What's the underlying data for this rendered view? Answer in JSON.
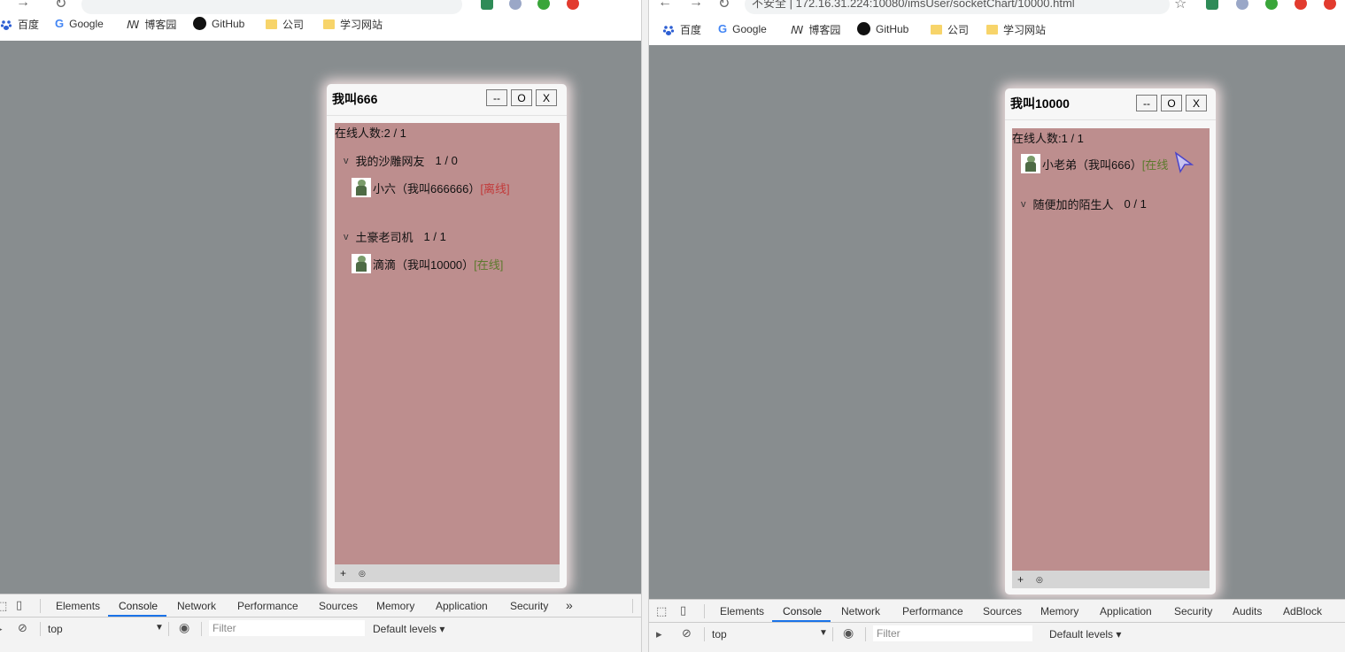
{
  "left": {
    "bookmarks": [
      "百度",
      "Google",
      "博客园",
      "GitHub",
      "公司",
      "学习网站"
    ],
    "qq": {
      "title": "我叫666",
      "buttons": [
        "--",
        "O",
        "X"
      ],
      "online": "在线人数:2 / 1",
      "groups": [
        {
          "name": "我的沙雕网友",
          "count": "1 / 0",
          "friend": {
            "name": "小六（我叫666666）",
            "status": "[离线]"
          }
        },
        {
          "name": "土豪老司机",
          "count": "1 / 1",
          "friend": {
            "name": "滴滴（我叫10000）",
            "status": "[在线]"
          }
        }
      ],
      "bottom": [
        "+",
        "◎"
      ]
    },
    "devtools": {
      "tabs": [
        "Elements",
        "Console",
        "Network",
        "Performance",
        "Sources",
        "Memory",
        "Application",
        "Security",
        "»"
      ],
      "active_tab": "Console",
      "context": "top",
      "filter_placeholder": "Filter",
      "levels": "Default levels ▾"
    }
  },
  "right": {
    "address": "不安全 | 172.16.31.224:10080/imsUser/socketChart/10000.html",
    "bookmarks": [
      "百度",
      "Google",
      "博客园",
      "GitHub",
      "公司",
      "学习网站"
    ],
    "qq": {
      "title": "我叫10000",
      "buttons": [
        "--",
        "O",
        "X"
      ],
      "online": "在线人数:1 / 1",
      "top_friend": {
        "name": "小老弟（我叫666）",
        "status": "[在线"
      },
      "groups": [
        {
          "name": "随便加的陌生人",
          "count": "0 / 1"
        }
      ],
      "bottom": [
        "+",
        "◎"
      ]
    },
    "devtools": {
      "tabs": [
        "Elements",
        "Console",
        "Network",
        "Performance",
        "Sources",
        "Memory",
        "Application",
        "Security",
        "Audits",
        "AdBlock"
      ],
      "active_tab": "Console",
      "context": "top",
      "filter_placeholder": "Filter",
      "levels": "Default levels ▾"
    }
  },
  "colors": {
    "viewport_bg": "#888d8f",
    "chat_panel_bg": "#bd8e8e",
    "offline": "#c23a3a",
    "online": "#5c7a2d",
    "devtools_active": "#1a73e8"
  }
}
